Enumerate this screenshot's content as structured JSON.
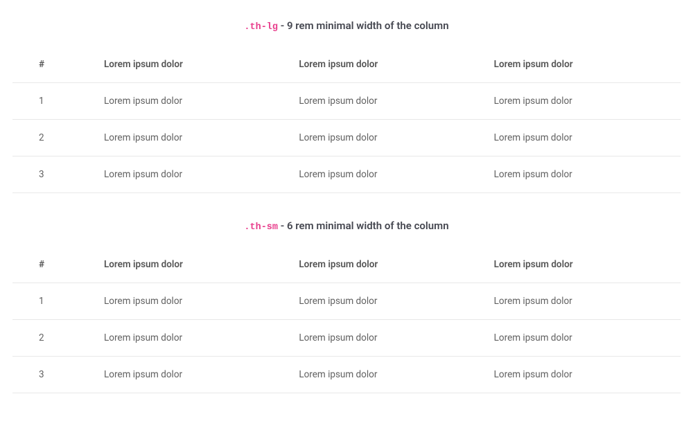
{
  "section1": {
    "code": ".th-lg",
    "description": " - 9 rem minimal width of the column",
    "headers": [
      "#",
      "Lorem ipsum dolor",
      "Lorem ipsum dolor",
      "Lorem ipsum dolor"
    ],
    "rows": [
      [
        "1",
        "Lorem ipsum dolor",
        "Lorem ipsum dolor",
        "Lorem ipsum dolor"
      ],
      [
        "2",
        "Lorem ipsum dolor",
        "Lorem ipsum dolor",
        "Lorem ipsum dolor"
      ],
      [
        "3",
        "Lorem ipsum dolor",
        "Lorem ipsum dolor",
        "Lorem ipsum dolor"
      ]
    ]
  },
  "section2": {
    "code": ".th-sm",
    "description": " - 6 rem minimal width of the column",
    "headers": [
      "#",
      "Lorem ipsum dolor",
      "Lorem ipsum dolor",
      "Lorem ipsum dolor"
    ],
    "rows": [
      [
        "1",
        "Lorem ipsum dolor",
        "Lorem ipsum dolor",
        "Lorem ipsum dolor"
      ],
      [
        "2",
        "Lorem ipsum dolor",
        "Lorem ipsum dolor",
        "Lorem ipsum dolor"
      ],
      [
        "3",
        "Lorem ipsum dolor",
        "Lorem ipsum dolor",
        "Lorem ipsum dolor"
      ]
    ]
  }
}
